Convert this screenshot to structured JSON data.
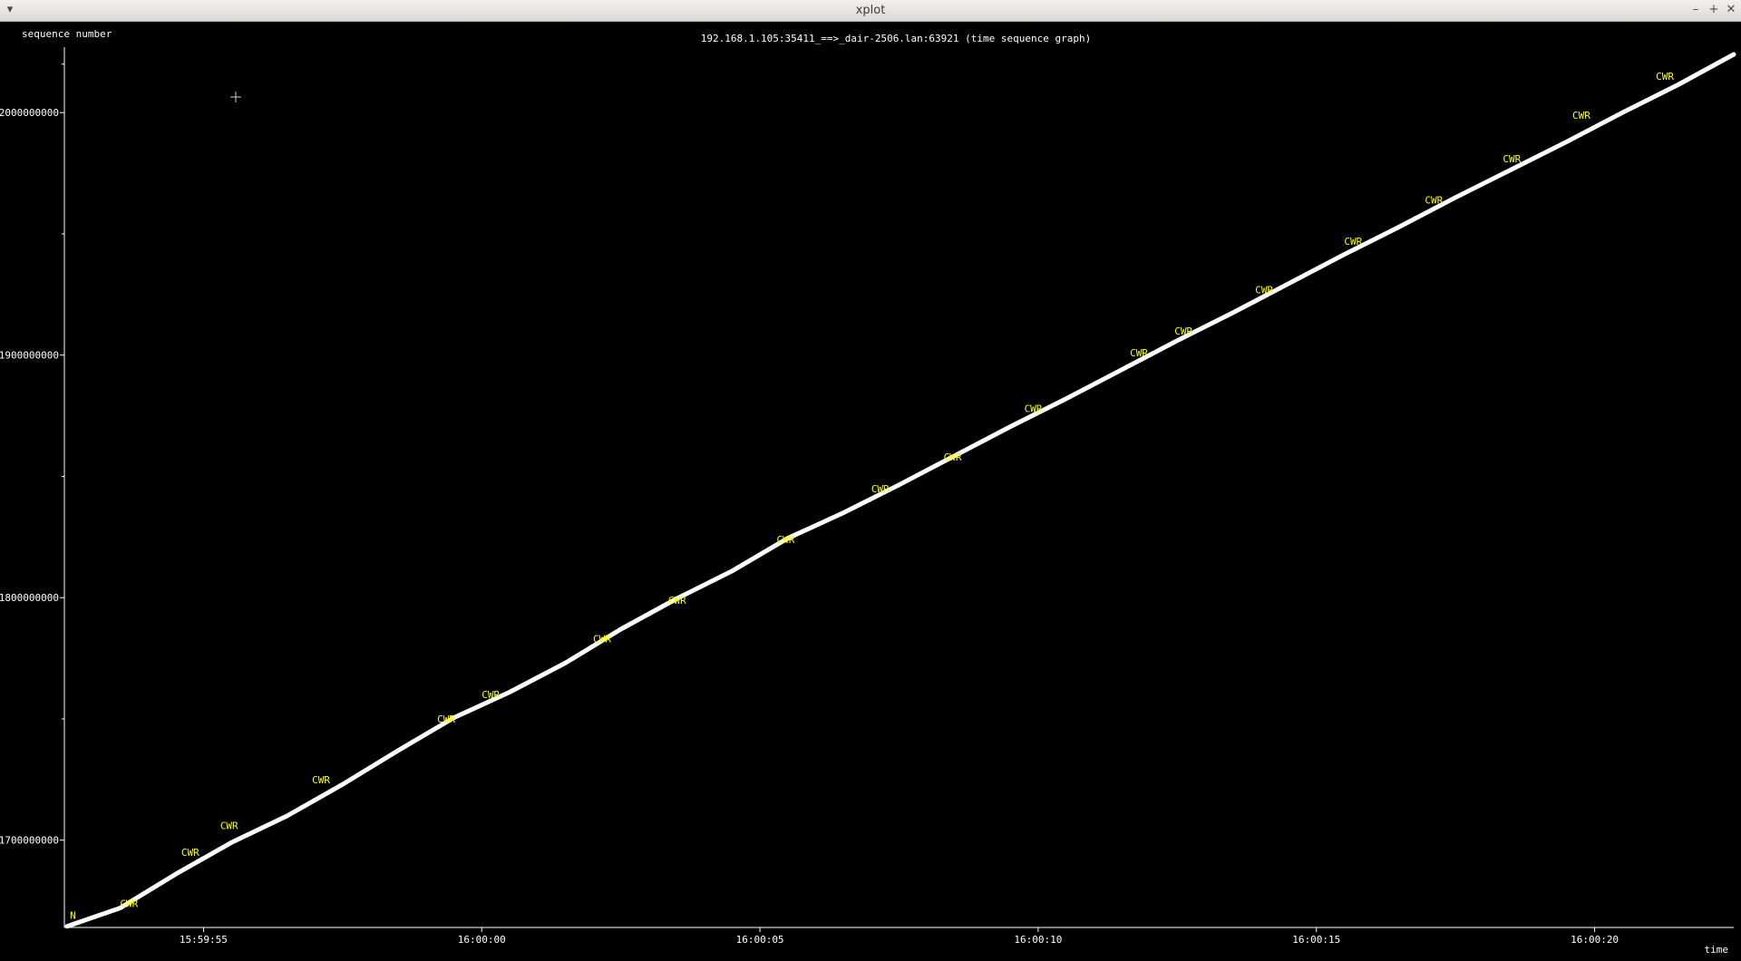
{
  "window": {
    "title": "xplot",
    "menu_icon": "chevron-down-icon",
    "minimize_icon": "minimize-icon",
    "maximize_icon": "maximize-icon",
    "close_icon": "close-icon"
  },
  "colors": {
    "background": "#000000",
    "axis": "#ffffff",
    "series": "#ffffff",
    "annotation": "#ffff00"
  },
  "chart_data": {
    "type": "line",
    "title": "192.168.1.105:35411_==>_dair-2506.lan:63921 (time sequence graph)",
    "xlabel": "time",
    "ylabel": "sequence number",
    "x_ticks": [
      {
        "t": 5,
        "label": "15:59:55"
      },
      {
        "t": 10,
        "label": "16:00:00"
      },
      {
        "t": 15,
        "label": "16:00:05"
      },
      {
        "t": 20,
        "label": "16:00:10"
      },
      {
        "t": 25,
        "label": "16:00:15"
      },
      {
        "t": 30,
        "label": "16:00:20"
      }
    ],
    "y_ticks": [
      {
        "v": 1700000000,
        "label": "1700000000"
      },
      {
        "v": 1800000000,
        "label": "1800000000"
      },
      {
        "v": 1900000000,
        "label": "1900000000"
      },
      {
        "v": 2000000000,
        "label": "2000000000"
      }
    ],
    "y_minor_ticks": [
      1750000000,
      1850000000,
      1950000000,
      2020000000
    ],
    "xlim": [
      2.5,
      32.5
    ],
    "ylim": [
      1664000000,
      2027000000
    ],
    "series": [
      {
        "points": [
          [
            2.55,
            1664500000
          ],
          [
            3.5,
            1672000000
          ],
          [
            4.5,
            1686000000
          ],
          [
            5.5,
            1699000000
          ],
          [
            6.5,
            1710000000
          ],
          [
            7.5,
            1723000000
          ],
          [
            8.5,
            1737000000
          ],
          [
            9.5,
            1750500000
          ],
          [
            10.5,
            1761000000
          ],
          [
            11.5,
            1773000000
          ],
          [
            12.5,
            1787000000
          ],
          [
            13.5,
            1799500000
          ],
          [
            14.5,
            1811000000
          ],
          [
            15.5,
            1824500000
          ],
          [
            16.5,
            1835000000
          ],
          [
            17.5,
            1846500000
          ],
          [
            18.5,
            1858500000
          ],
          [
            19.5,
            1870500000
          ],
          [
            20.5,
            1882000000
          ],
          [
            21.5,
            1894000000
          ],
          [
            22.5,
            1906000000
          ],
          [
            23.5,
            1917500000
          ],
          [
            24.5,
            1929500000
          ],
          [
            25.5,
            1941500000
          ],
          [
            26.5,
            1953000000
          ],
          [
            27.5,
            1965000000
          ],
          [
            28.5,
            1976500000
          ],
          [
            29.5,
            1988000000
          ],
          [
            30.5,
            2000000000
          ],
          [
            31.5,
            2011500000
          ],
          [
            32.5,
            2024000000
          ]
        ]
      }
    ],
    "annotations": [
      {
        "t": 2.6,
        "v": 1666000000,
        "label": "N"
      },
      {
        "t": 3.5,
        "v": 1671000000,
        "label": "CWR"
      },
      {
        "t": 4.6,
        "v": 1692000000,
        "label": "CWR"
      },
      {
        "t": 5.3,
        "v": 1703000000,
        "label": "CWR"
      },
      {
        "t": 6.95,
        "v": 1722000000,
        "label": "CWR"
      },
      {
        "t": 9.2,
        "v": 1747000000,
        "label": "CWR"
      },
      {
        "t": 10.0,
        "v": 1757000000,
        "label": "CWR"
      },
      {
        "t": 12.0,
        "v": 1780000000,
        "label": "CWR"
      },
      {
        "t": 13.35,
        "v": 1796000000,
        "label": "CWR"
      },
      {
        "t": 15.3,
        "v": 1821000000,
        "label": "CWR"
      },
      {
        "t": 17.0,
        "v": 1842000000,
        "label": "CWR"
      },
      {
        "t": 18.3,
        "v": 1855000000,
        "label": "CWR"
      },
      {
        "t": 19.75,
        "v": 1875000000,
        "label": "CWR"
      },
      {
        "t": 21.65,
        "v": 1898000000,
        "label": "CWR"
      },
      {
        "t": 22.45,
        "v": 1907000000,
        "label": "CWR"
      },
      {
        "t": 23.9,
        "v": 1924000000,
        "label": "CWR"
      },
      {
        "t": 25.5,
        "v": 1944000000,
        "label": "CWR"
      },
      {
        "t": 26.95,
        "v": 1961000000,
        "label": "CWR"
      },
      {
        "t": 28.35,
        "v": 1978000000,
        "label": "CWR"
      },
      {
        "t": 29.6,
        "v": 1996000000,
        "label": "CWR"
      },
      {
        "t": 31.1,
        "v": 2012000000,
        "label": "CWR"
      }
    ]
  }
}
